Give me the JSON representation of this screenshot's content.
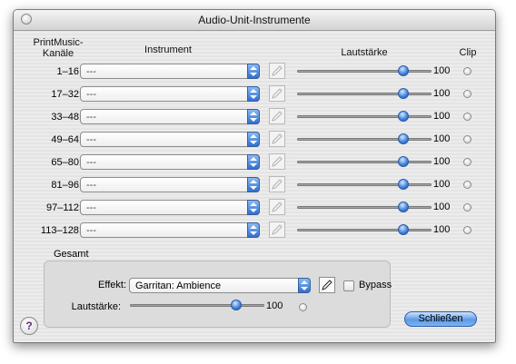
{
  "window": {
    "title": "Audio-Unit-Instrumente"
  },
  "headers": {
    "channels_line1": "PrintMusic-",
    "channels_line2": "Kanäle",
    "instrument": "Instrument",
    "volume": "Lautstärke",
    "clip": "Clip"
  },
  "rows": [
    {
      "channels": "1–16:",
      "instrument": "---",
      "volume": 100,
      "volume_label": "100"
    },
    {
      "channels": "17–32:",
      "instrument": "---",
      "volume": 100,
      "volume_label": "100"
    },
    {
      "channels": "33–48:",
      "instrument": "---",
      "volume": 100,
      "volume_label": "100"
    },
    {
      "channels": "49–64:",
      "instrument": "---",
      "volume": 100,
      "volume_label": "100"
    },
    {
      "channels": "65–80:",
      "instrument": "---",
      "volume": 100,
      "volume_label": "100"
    },
    {
      "channels": "81–96:",
      "instrument": "---",
      "volume": 100,
      "volume_label": "100"
    },
    {
      "channels": "97–112:",
      "instrument": "---",
      "volume": 100,
      "volume_label": "100"
    },
    {
      "channels": "113–128:",
      "instrument": "---",
      "volume": 100,
      "volume_label": "100"
    }
  ],
  "slider_max": 127,
  "master": {
    "group_label": "Gesamt",
    "effect_label": "Effekt:",
    "effect_value": "Garritan: Ambience",
    "bypass_label": "Bypass",
    "bypass_checked": false,
    "volume_label": "Lautstärke:",
    "volume": 100,
    "volume_value": "100"
  },
  "buttons": {
    "close": "Schließen",
    "help": "?"
  },
  "icons": {
    "popup": "updown-arrows-icon",
    "edit": "pencil-icon",
    "clip": "clip-indicator-icon",
    "window_close": "window-close-icon"
  },
  "colors": {
    "accent": "#3d7fd9",
    "window_bg": "#e8e8e8"
  }
}
